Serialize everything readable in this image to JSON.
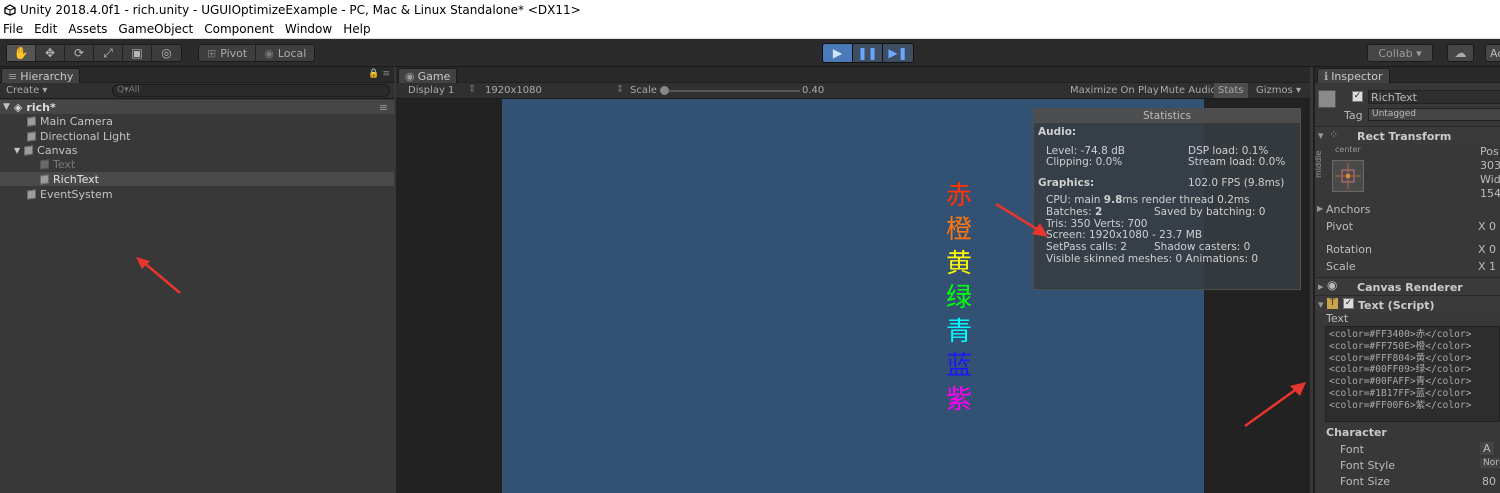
{
  "window": {
    "title": "Unity 2018.4.0f1 - rich.unity - UGUIOptimizeExample - PC, Mac & Linux Standalone* <DX11>"
  },
  "menu": [
    "File",
    "Edit",
    "Assets",
    "GameObject",
    "Component",
    "Window",
    "Help"
  ],
  "toolbar": {
    "pivot": "Pivot",
    "local": "Local",
    "collab": "Collab ▾",
    "account": "Ac"
  },
  "hierarchy": {
    "tab": "Hierarchy",
    "create": "Create ▾",
    "search_placeholder": "Q▾All",
    "scene": "rich*",
    "items": [
      "Main Camera",
      "Directional Light",
      "Canvas",
      "Text",
      "RichText",
      "EventSystem"
    ]
  },
  "game": {
    "tab": "Game",
    "display": "Display 1",
    "resolution": "1920x1080",
    "scale_label": "Scale",
    "scale_value": "0.40",
    "maximize": "Maximize On Play",
    "mute": "Mute Audio",
    "stats_btn": "Stats",
    "gizmos": "Gizmos ▾",
    "chars": [
      "赤",
      "橙",
      "黄",
      "绿",
      "青",
      "蓝",
      "紫"
    ],
    "char_colors": [
      "#FF3400",
      "#FF750E",
      "#FFF804",
      "#00FF09",
      "#00FAFF",
      "#1B17FF",
      "#FF00F6"
    ]
  },
  "stats": {
    "title": "Statistics",
    "audio": "Audio:",
    "level": "Level: -74.8 dB",
    "clipping": "Clipping: 0.0%",
    "dsp": "DSP load: 0.1%",
    "stream": "Stream load: 0.0%",
    "graphics": "Graphics:",
    "fps": "102.0 FPS (9.8ms)",
    "cpu_pre": "CPU: main ",
    "cpu_main": "9.8",
    "cpu_post": "ms  render thread 0.2ms",
    "batches_pre": "Batches: ",
    "batches": "2",
    "saved": "Saved by batching: 0",
    "tris": "Tris: 350  Verts: 700",
    "screen": "Screen: 1920x1080 - 23.7 MB",
    "setpass": "SetPass calls: 2",
    "shadow": "Shadow casters: 0",
    "skinned": "Visible skinned meshes: 0  Animations: 0"
  },
  "inspector": {
    "tab": "Inspector",
    "object_name": "RichText",
    "tag_label": "Tag",
    "tag_value": "Untagged",
    "rect_transform": "Rect Transform",
    "center": "center",
    "middle": "middle",
    "pos": "Pos",
    "pos_val": "303",
    "wid": "Wid",
    "wid_val": "154",
    "anchors": "Anchors",
    "pivot": "Pivot",
    "rotation": "Rotation",
    "scale": "Scale",
    "x0": "X 0",
    "x1": "X 1",
    "canvas_renderer": "Canvas Renderer",
    "text_script": "Text (Script)",
    "text_label": "Text",
    "text_lines": [
      "<color=#FF3400>赤</color>",
      "<color=#FF750E>橙</color>",
      "<color=#FFF804>黄</color>",
      "<color=#00FF09>绿</color>",
      "<color=#00FAFF>青</color>",
      "<color=#1B17FF>蓝</color>",
      "<color=#FF00F6>紫</color>"
    ],
    "character": "Character",
    "font": "Font",
    "font_val": "A",
    "font_style": "Font Style",
    "font_style_val": "Nor",
    "font_size": "Font Size",
    "font_size_val": "80"
  }
}
